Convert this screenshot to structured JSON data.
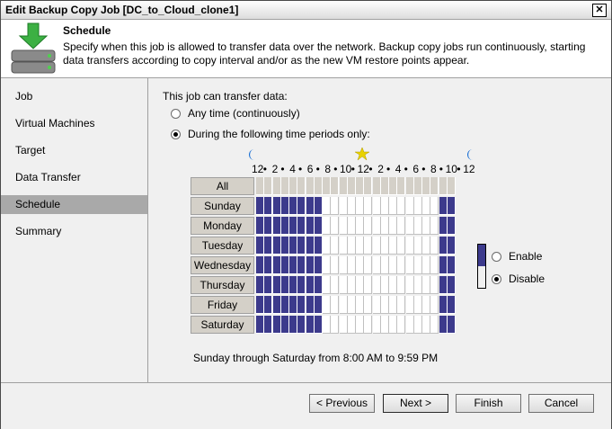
{
  "window": {
    "title": "Edit Backup Copy Job [DC_to_Cloud_clone1]",
    "close_label": "✕"
  },
  "header": {
    "title": "Schedule",
    "description": "Specify when this job is allowed to transfer data over the network. Backup copy jobs run continuously, starting data transfers according to copy interval and/or as the new VM restore points appear."
  },
  "sidebar": {
    "items": [
      {
        "label": "Job"
      },
      {
        "label": "Virtual Machines"
      },
      {
        "label": "Target"
      },
      {
        "label": "Data Transfer"
      },
      {
        "label": "Schedule",
        "active": true
      },
      {
        "label": "Summary"
      }
    ]
  },
  "content": {
    "can_transfer_label": "This job can transfer data:",
    "option_any_time": "Any time (continuously)",
    "option_periods": "During the following time periods only:",
    "selected_option": "periods",
    "time_labels": [
      "12",
      "•",
      "2",
      "•",
      "4",
      "•",
      "6",
      "•",
      "8",
      "•",
      "10",
      "•",
      "12",
      "•",
      "2",
      "•",
      "4",
      "•",
      "6",
      "•",
      "8",
      "•",
      "10",
      "•",
      "12"
    ],
    "days": [
      "Sunday",
      "Monday",
      "Tuesday",
      "Wednesday",
      "Thursday",
      "Friday",
      "Saturday"
    ],
    "all_label": "All",
    "enable_label": "Enable",
    "disable_label": "Disable",
    "selected_mode": "disable",
    "enabled_hours": {
      "start": 8,
      "end": 22
    },
    "summary": "Sunday through Saturday from 8:00 AM to 9:59 PM",
    "colors": {
      "disabled": "#3c3a8c",
      "enabled": "#ffffff",
      "moon": "#1a6fd4",
      "sun": "#e8d200"
    }
  },
  "footer": {
    "previous_label": "< Previous",
    "next_label": "Next >",
    "finish_label": "Finish",
    "cancel_label": "Cancel"
  }
}
